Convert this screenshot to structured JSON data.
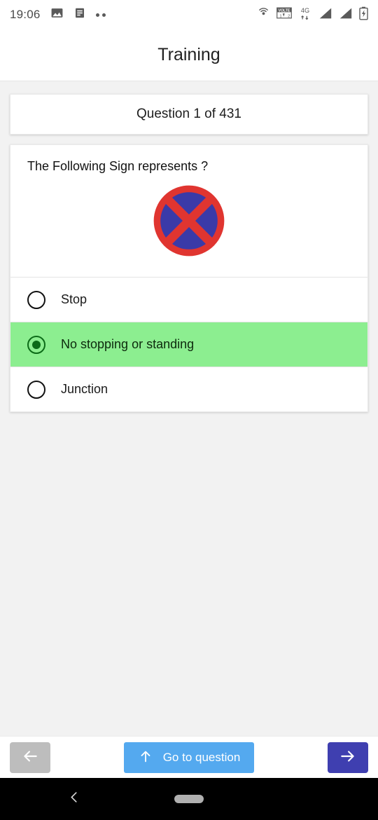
{
  "status_bar": {
    "time": "19:06",
    "left_icons": [
      "image-icon",
      "notification-text-icon",
      "more-dots-icon"
    ],
    "right_icons": [
      "hotspot-icon",
      "volte-icon",
      "4g-data-icon",
      "signal-bars-sim1-icon",
      "signal-bars-sim2-icon",
      "battery-charging-icon"
    ],
    "network_label": "4G",
    "volte_label": "VOLTE"
  },
  "app_bar": {
    "title": "Training"
  },
  "question_counter": {
    "text": "Question 1 of 431"
  },
  "question": {
    "prompt": "The Following Sign represents ?",
    "image_name": "no-stopping-road-sign",
    "image_colors": {
      "ring": "#e03530",
      "field": "#3a3aa8",
      "cross": "#e03530"
    }
  },
  "options": [
    {
      "label": "Stop",
      "selected": false
    },
    {
      "label": "No stopping or standing",
      "selected": true
    },
    {
      "label": "Junction",
      "selected": false
    }
  ],
  "bottom_bar": {
    "prev_icon": "arrow-left-icon",
    "goto_label": "Go to question",
    "goto_icon": "arrow-up-icon",
    "next_icon": "arrow-right-icon",
    "colors": {
      "prev": "#bdbdbd",
      "goto": "#54a9ef",
      "next": "#3f3fb0"
    }
  },
  "android_nav": {
    "back_icon": "chevron-left-icon",
    "home_pill": "home-gesture-pill"
  },
  "theme": {
    "background": "#f2f2f2",
    "card": "#ffffff",
    "selected_option": "#8cee90",
    "selected_radio": "#0c6b18"
  }
}
